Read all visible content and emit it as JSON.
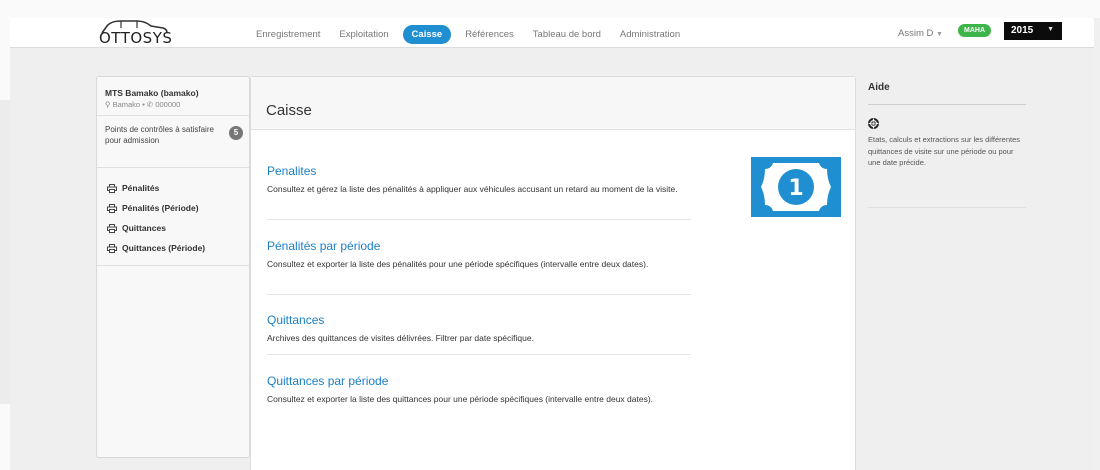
{
  "brand": {
    "logo_text": "OTTOSYS"
  },
  "nav": {
    "items": [
      {
        "label": "Enregistrement"
      },
      {
        "label": "Exploitation"
      },
      {
        "label": "Caisse"
      },
      {
        "label": "Références"
      },
      {
        "label": "Tableau de bord"
      },
      {
        "label": "Administration"
      }
    ],
    "active": "Caisse"
  },
  "user": {
    "name": "Assim D",
    "badge": "MAHA",
    "year": "2015"
  },
  "sidebar": {
    "org_name": "MTS Bamako (bamako)",
    "org_location": "Bamako",
    "org_phone": "000000",
    "points_label": "Points de contrôles à satisfaire pour admission",
    "points_count": "5",
    "items": [
      {
        "label": "Pénalités",
        "icon": "printer-icon"
      },
      {
        "label": "Pénalités (Période)",
        "icon": "printer-icon"
      },
      {
        "label": "Quittances",
        "icon": "printer-icon"
      },
      {
        "label": "Quittances (Période)",
        "icon": "printer-icon"
      }
    ]
  },
  "main": {
    "title": "Caisse",
    "icon": "money-bill-icon",
    "entries": [
      {
        "title": "Penalites",
        "desc": "Consultez et gérez la liste des pénalités à appliquer aux véhicules accusant un retard au moment de la visite."
      },
      {
        "title": "Pénalités par période",
        "desc": "Consultez et exporter la liste des pénalités pour une période spécifiques (intervalle entre deux dates)."
      },
      {
        "title": "Quittances",
        "desc": "Archives des quittances de visites délivrées. Filtrer par date spécifique."
      },
      {
        "title": "Quittances par période",
        "desc": "Consultez et exporter la liste des quittances pour une période spécifiques (intervalle entre deux dates)."
      }
    ]
  },
  "help": {
    "title": "Aide",
    "icon": "lifebuoy-icon",
    "text": "Etats, calculs et extractions sur les différentes quittances de visite sur une période ou pour une date précide."
  },
  "colors": {
    "accent": "#1f8fd1",
    "link": "#1a7fc4",
    "badge_green": "#3db54a",
    "year_bg": "#0c0c0c"
  }
}
